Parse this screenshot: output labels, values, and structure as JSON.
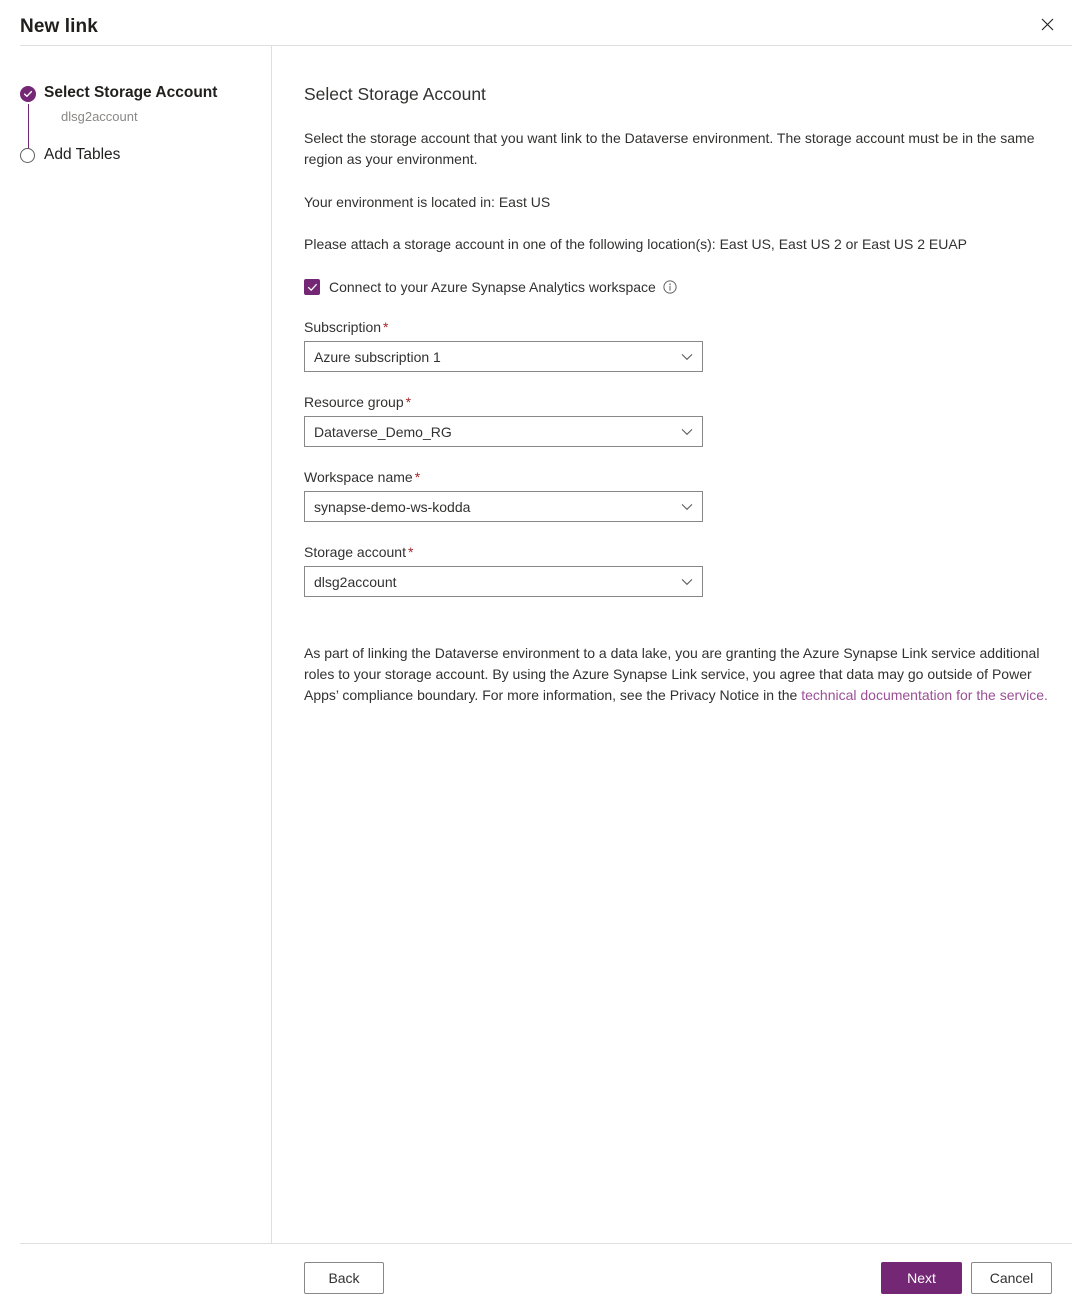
{
  "dialog": {
    "title": "New link",
    "close_icon": "close-icon"
  },
  "wizard": {
    "steps": [
      {
        "label": "Select Storage Account",
        "sublabel": "dlsg2account",
        "state": "completed",
        "marker_icon": "check-circle-icon"
      },
      {
        "label": "Add Tables",
        "sublabel": "",
        "state": "upcoming",
        "marker_icon": "empty-circle-icon"
      }
    ]
  },
  "panel": {
    "heading": "Select Storage Account",
    "intro": "Select the storage account that you want link to the Dataverse environment. The storage account must be in the same region as your environment.",
    "region_line": "Your environment is located in: East US",
    "locations_line": "Please attach a storage account in one of the following location(s): East US, East US 2 or East US 2 EUAP",
    "synapse_checkbox": {
      "label": "Connect to your Azure Synapse Analytics workspace",
      "checked": true,
      "info_icon": "info-icon"
    },
    "fields": [
      {
        "label": "Subscription",
        "required": true,
        "value": "Azure subscription 1",
        "name": "subscription"
      },
      {
        "label": "Resource group",
        "required": true,
        "value": "Dataverse_Demo_RG",
        "name": "resource-group"
      },
      {
        "label": "Workspace name",
        "required": true,
        "value": "synapse-demo-ws-kodda",
        "name": "workspace-name"
      },
      {
        "label": "Storage account",
        "required": true,
        "value": "dlsg2account",
        "name": "storage-account"
      }
    ],
    "consent": {
      "text_before": "As part of linking the Dataverse environment to a data lake, you are granting the Azure Synapse Link service additional roles to your storage account. By using the Azure Synapse Link service, you agree that data may go outside of Power Apps’ compliance boundary. For more information, see the Privacy Notice in the ",
      "link_text": "technical documentation for the service.",
      "link_color": "#9b4f96"
    },
    "required_marker": "*"
  },
  "footer": {
    "back_label": "Back",
    "next_label": "Next",
    "cancel_label": "Cancel"
  },
  "theme": {
    "accent": "#742774",
    "required_red": "#a4262c",
    "border": "#8a8886",
    "divider": "#e1dfdd",
    "text": "#323130",
    "muted_text": "#8a8886"
  }
}
